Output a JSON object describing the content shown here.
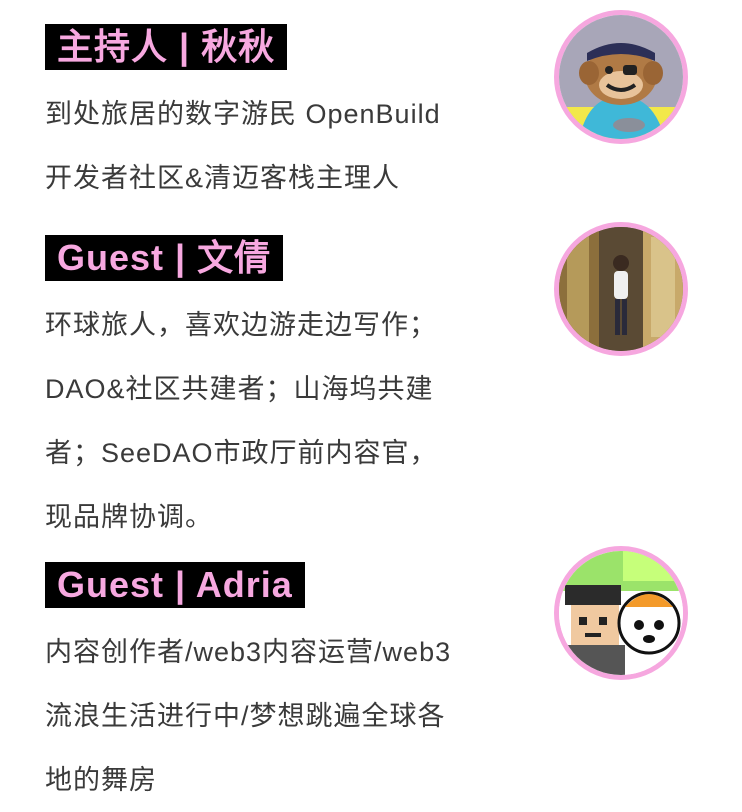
{
  "hosts": [
    {
      "title": "主持人 | 秋秋",
      "bio_lines": [
        "到处旅居的数字游民 OpenBuild",
        "开发者社区&清迈客栈主理人"
      ],
      "avatar_icon": "monkey-pirate-avatar"
    },
    {
      "title": "Guest | 文倩",
      "bio_lines": [
        "环球旅人，喜欢边游走边写作；",
        "DAO&社区共建者；山海坞共建",
        "者；SeeDAO市政厅前内容官，",
        "现品牌协调。"
      ],
      "avatar_icon": "temple-photo-avatar"
    },
    {
      "title": "Guest | Adria",
      "bio_lines": [
        "内容创作者/web3内容运营/web3",
        "流浪生活进行中/梦想跳遍全球各",
        "地的舞房"
      ],
      "avatar_icon": "pixel-duo-avatar"
    }
  ],
  "colors": {
    "title_bg": "#000000",
    "title_text": "#f7a8e0",
    "avatar_ring": "#f6a7df",
    "bio_text": "#3a3a3a"
  }
}
